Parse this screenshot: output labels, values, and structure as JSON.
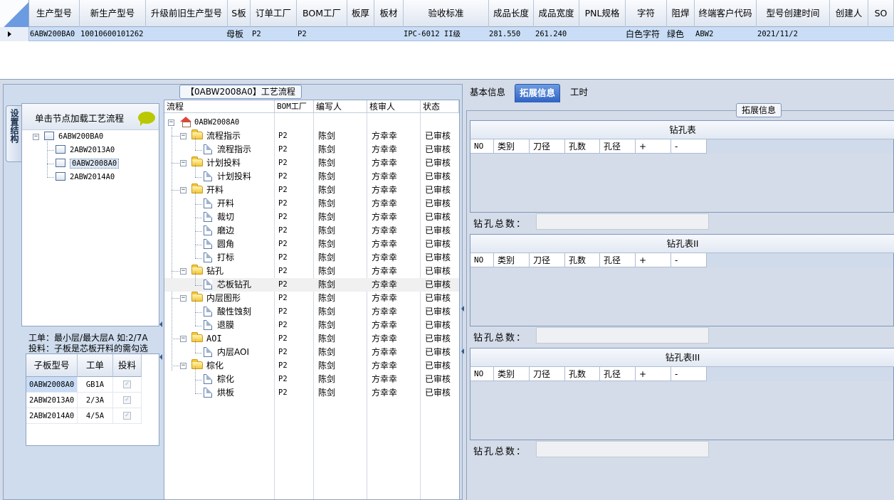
{
  "top_grid": {
    "columns": [
      "生产型号",
      "新生产型号",
      "升级前旧生产型号",
      "S板",
      "订单工厂",
      "BOM工厂",
      "板厚",
      "板材",
      "验收标准",
      "成品长度",
      "成品宽度",
      "PNL规格",
      "字符",
      "阻焊",
      "终端客户代码",
      "型号创建时间",
      "创建人",
      "SO"
    ],
    "row": {
      "model": "6ABW200BA0",
      "new_model": "10010600101262",
      "s_board": "母板",
      "order_factory": "P2",
      "bom_factory": "P2",
      "standard": "IPC-6012 II级",
      "length": "281.550",
      "width": "261.240",
      "character": "白色字符",
      "solder_mask": "绿色",
      "customer_code": "ABW2",
      "created": "2021/11/2"
    }
  },
  "left": {
    "caption": "【0ABW2008A0】工艺流程",
    "side_tab": "设置结构",
    "tree_title": "单击节点加载工艺流程",
    "tree": {
      "root": "6ABW200BA0",
      "children": [
        "2ABW2013A0",
        "0ABW2008A0",
        "2ABW2014A0"
      ]
    },
    "notes": [
      "工单：最小层/最大层A 如:2/7A",
      "投料：子板是芯板开料的需勾选"
    ],
    "sub_grid": {
      "headers": [
        "子板型号",
        "工单",
        "投料"
      ],
      "rows": [
        {
          "model": "0ABW2008A0",
          "order": "GB1A",
          "feed": "✓"
        },
        {
          "model": "2ABW2013A0",
          "order": "2/3A",
          "feed": "✓"
        },
        {
          "model": "2ABW2014A0",
          "order": "4/5A",
          "feed": "✓"
        }
      ]
    },
    "flow": {
      "headers": [
        "流程",
        "BOM工厂",
        "编写人",
        "核审人",
        "状态"
      ],
      "root": "0ABW2008A0",
      "rows": [
        {
          "name": "流程指示",
          "factory": "P2",
          "writer": "陈剑",
          "reviewer": "方幸幸",
          "status": "已审核"
        },
        {
          "name": "流程指示",
          "factory": "P2",
          "writer": "陈剑",
          "reviewer": "方幸幸",
          "status": "已审核"
        },
        {
          "name": "计划投料",
          "factory": "P2",
          "writer": "陈剑",
          "reviewer": "方幸幸",
          "status": "已审核"
        },
        {
          "name": "计划投料",
          "factory": "P2",
          "writer": "陈剑",
          "reviewer": "方幸幸",
          "status": "已审核"
        },
        {
          "name": "开料",
          "factory": "P2",
          "writer": "陈剑",
          "reviewer": "方幸幸",
          "status": "已审核"
        },
        {
          "name": "开料",
          "factory": "P2",
          "writer": "陈剑",
          "reviewer": "方幸幸",
          "status": "已审核"
        },
        {
          "name": "裁切",
          "factory": "P2",
          "writer": "陈剑",
          "reviewer": "方幸幸",
          "status": "已审核"
        },
        {
          "name": "磨边",
          "factory": "P2",
          "writer": "陈剑",
          "reviewer": "方幸幸",
          "status": "已审核"
        },
        {
          "name": "圆角",
          "factory": "P2",
          "writer": "陈剑",
          "reviewer": "方幸幸",
          "status": "已审核"
        },
        {
          "name": "打标",
          "factory": "P2",
          "writer": "陈剑",
          "reviewer": "方幸幸",
          "status": "已审核"
        },
        {
          "name": "钻孔",
          "factory": "P2",
          "writer": "陈剑",
          "reviewer": "方幸幸",
          "status": "已审核"
        },
        {
          "name": "芯板钻孔",
          "factory": "P2",
          "writer": "陈剑",
          "reviewer": "方幸幸",
          "status": "已审核"
        },
        {
          "name": "内层图形",
          "factory": "P2",
          "writer": "陈剑",
          "reviewer": "方幸幸",
          "status": "已审核"
        },
        {
          "name": "酸性蚀刻",
          "factory": "P2",
          "writer": "陈剑",
          "reviewer": "方幸幸",
          "status": "已审核"
        },
        {
          "name": "退膜",
          "factory": "P2",
          "writer": "陈剑",
          "reviewer": "方幸幸",
          "status": "已审核"
        },
        {
          "name": "AOI",
          "factory": "P2",
          "writer": "陈剑",
          "reviewer": "方幸幸",
          "status": "已审核"
        },
        {
          "name": "内层AOI",
          "factory": "P2",
          "writer": "陈剑",
          "reviewer": "方幸幸",
          "status": "已审核"
        },
        {
          "name": "棕化",
          "factory": "P2",
          "writer": "陈剑",
          "reviewer": "方幸幸",
          "status": "已审核"
        },
        {
          "name": "棕化",
          "factory": "P2",
          "writer": "陈剑",
          "reviewer": "方幸幸",
          "status": "已审核"
        },
        {
          "name": "烘板",
          "factory": "P2",
          "writer": "陈剑",
          "reviewer": "方幸幸",
          "status": "已审核"
        }
      ]
    }
  },
  "right": {
    "tabs": [
      "基本信息",
      "拓展信息",
      "工时"
    ],
    "group_caption": "拓展信息",
    "drill_tables": [
      {
        "title": "钻孔表",
        "headers": [
          "NO",
          "类别",
          "刀径",
          "孔数",
          "孔径",
          "+",
          "-"
        ],
        "total_label": "钻孔总数："
      },
      {
        "title": "钻孔表II",
        "headers": [
          "NO",
          "类别",
          "刀径",
          "孔数",
          "孔径",
          "+",
          "-"
        ],
        "total_label": "钻孔总数："
      },
      {
        "title": "钻孔表III",
        "headers": [
          "NO",
          "类别",
          "刀径",
          "孔数",
          "孔径",
          "+",
          "-"
        ],
        "total_label": "钻孔总数："
      }
    ]
  }
}
